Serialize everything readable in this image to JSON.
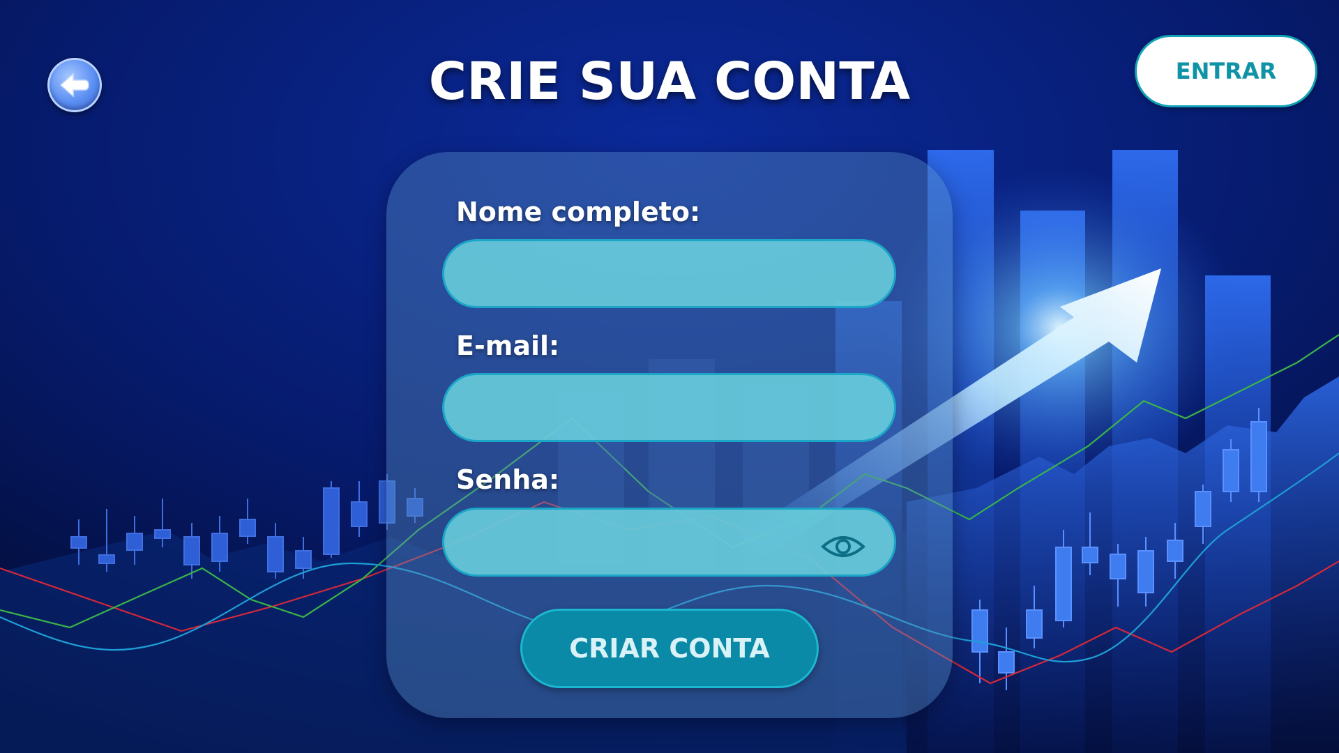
{
  "header": {
    "title": "CRIE SUA CONTA",
    "back_icon": "back-arrow-icon",
    "login_label": "ENTRAR"
  },
  "form": {
    "fields": [
      {
        "label": "Nome completo:",
        "value": "",
        "placeholder": ""
      },
      {
        "label": "E-mail:",
        "value": "",
        "placeholder": ""
      },
      {
        "label": "Senha:",
        "value": "",
        "placeholder": "",
        "toggle_icon": "eye-icon"
      }
    ],
    "submit_label": "CRIAR CONTA"
  },
  "colors": {
    "background": "#04113f",
    "accent": "#0f93a6",
    "field_fill": "#68cddc",
    "submit_fill": "#0a8aa6"
  }
}
